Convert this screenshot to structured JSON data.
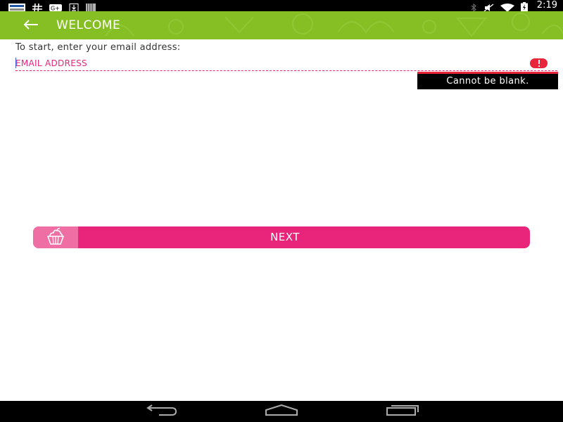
{
  "status_bar": {
    "time": "2:19",
    "icons_left": [
      "news-icon",
      "hash-icon",
      "google-plus-icon",
      "download-icon",
      "barcode-icon"
    ],
    "icons_right": [
      "bluetooth-icon",
      "mute-icon",
      "wifi-icon",
      "battery-charging-icon"
    ]
  },
  "app_bar": {
    "title": "WELCOME",
    "background_color": "#86bf24"
  },
  "form": {
    "prompt": "To start, enter your email address:",
    "email_placeholder": "EMAIL ADDRESS",
    "email_value": "",
    "error_message": "Cannot be blank."
  },
  "next_button": {
    "label": "NEXT",
    "icon": "cupcake-icon",
    "color": "#e8257b"
  },
  "nav_bar": {
    "buttons": [
      "back-nav-icon",
      "home-nav-icon",
      "recents-nav-icon"
    ]
  }
}
